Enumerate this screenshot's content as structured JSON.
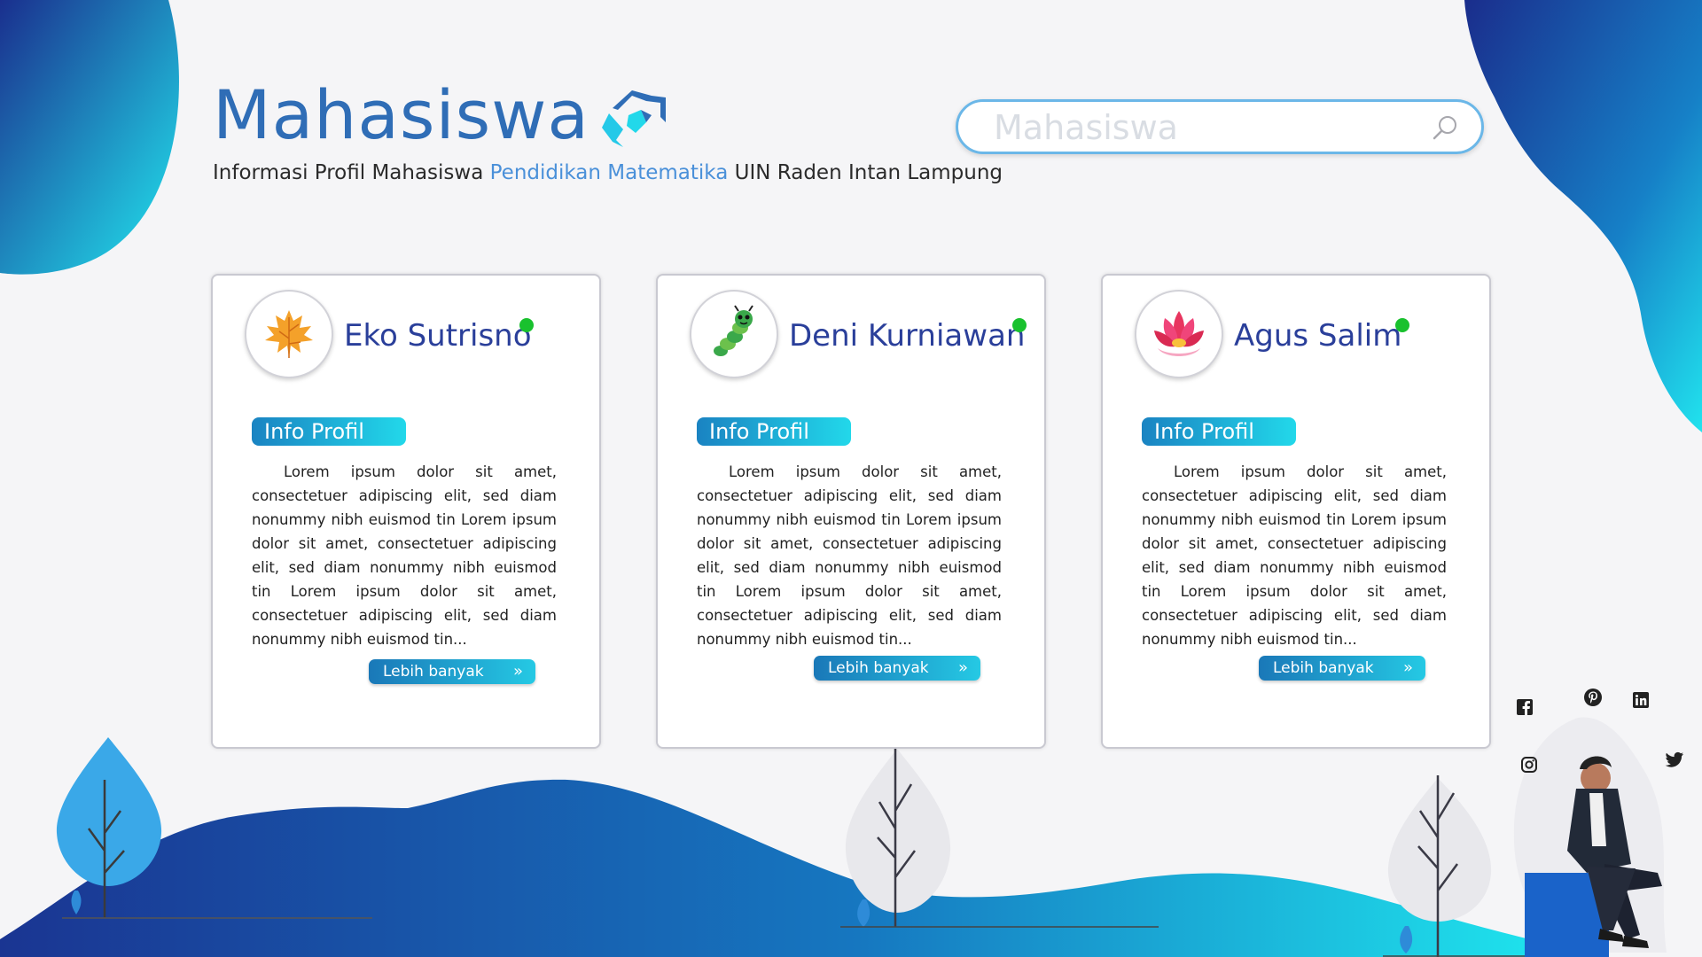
{
  "header": {
    "title": "Mahasiswa",
    "subtitle_part1": "Informasi Profil Mahasiswa ",
    "subtitle_accent": "Pendidikan Matematika",
    "subtitle_part2": " UIN Raden Intan Lampung"
  },
  "search": {
    "placeholder": "Mahasiswa",
    "icon": "search-icon"
  },
  "cards": [
    {
      "name": "Eko Sutrisno",
      "avatar_icon": "maple-leaf-icon",
      "status": "online",
      "badge": "Info Profil",
      "description": "Lorem ipsum dolor sit amet, consectetuer adipiscing elit, sed diam nonummy nibh euismod tin Lorem ipsum dolor sit amet, consectetuer adipiscing elit, sed diam nonummy nibh euismod tin Lorem ipsum dolor sit amet, consectetuer adipiscing elit, sed diam nonummy nibh euismod tin...",
      "button": "Lebih banyak"
    },
    {
      "name": "Deni Kurniawan",
      "avatar_icon": "caterpillar-icon",
      "status": "online",
      "badge": "Info Profil",
      "description": "Lorem ipsum dolor sit amet, consectetuer adipiscing elit, sed diam nonummy nibh euismod tin Lorem ipsum dolor sit amet, consectetuer adipiscing elit, sed diam nonummy nibh euismod tin Lorem ipsum dolor sit amet, consectetuer adipiscing elit, sed diam nonummy nibh euismod tin...",
      "button": "Lebih banyak"
    },
    {
      "name": "Agus Salim",
      "avatar_icon": "lotus-icon",
      "status": "online",
      "badge": "Info Profil",
      "description": "Lorem ipsum dolor sit amet, consectetuer adipiscing elit, sed diam nonummy nibh euismod tin Lorem ipsum dolor sit amet, consectetuer adipiscing elit, sed diam nonummy nibh euismod tin Lorem ipsum dolor sit amet, consectetuer adipiscing elit, sed diam nonummy nibh euismod tin...",
      "button": "Lebih banyak"
    }
  ],
  "social": [
    "facebook-icon",
    "pinterest-icon",
    "linkedin-icon",
    "instagram-icon",
    "twitter-icon"
  ],
  "colors": {
    "brand": "#2f6db6",
    "name": "#2a3f9a",
    "accent": "#4a90d9",
    "gradient_dark": "#1a3f9a",
    "gradient_light": "#22e6f0",
    "online": "#19c12e"
  }
}
